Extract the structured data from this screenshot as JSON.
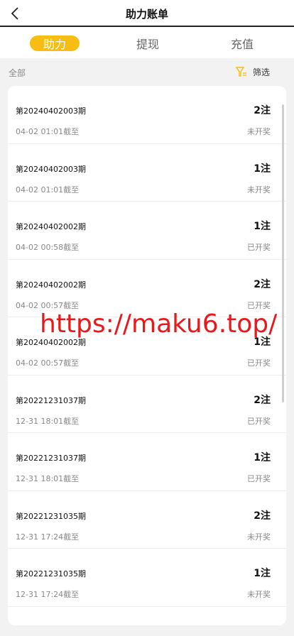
{
  "header": {
    "title": "助力账单"
  },
  "tabs": [
    {
      "label": "助力",
      "active": true
    },
    {
      "label": "提现",
      "active": false
    },
    {
      "label": "充值",
      "active": false
    }
  ],
  "filter": {
    "all_label": "全部",
    "filter_label": "筛选"
  },
  "records": [
    {
      "period": "第20240402003期",
      "count": "2注",
      "deadline": "04-02 01:01截至",
      "status": "未开奖"
    },
    {
      "period": "第20240402003期",
      "count": "1注",
      "deadline": "04-02 01:01截至",
      "status": "未开奖"
    },
    {
      "period": "第20240402002期",
      "count": "1注",
      "deadline": "04-02 00:58截至",
      "status": "已开奖"
    },
    {
      "period": "第20240402002期",
      "count": "2注",
      "deadline": "04-02 00:57截至",
      "status": "已开奖"
    },
    {
      "period": "第20240402002期",
      "count": "1注",
      "deadline": "04-02 00:57截至",
      "status": "已开奖"
    },
    {
      "period": "第20221231037期",
      "count": "2注",
      "deadline": "12-31 18:01截至",
      "status": "已开奖"
    },
    {
      "period": "第20221231037期",
      "count": "1注",
      "deadline": "12-31 18:01截至",
      "status": "已开奖"
    },
    {
      "period": "第20221231035期",
      "count": "2注",
      "deadline": "12-31 17:24截至",
      "status": "未开奖"
    },
    {
      "period": "第20221231035期",
      "count": "1注",
      "deadline": "12-31 17:24截至",
      "status": "未开奖"
    }
  ],
  "watermark": "https://maku6.top/",
  "colors": {
    "accent": "#f7bd12",
    "watermark": "#e8191b"
  }
}
